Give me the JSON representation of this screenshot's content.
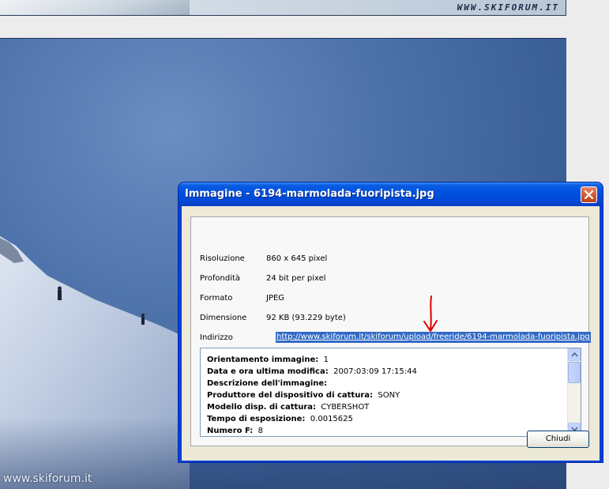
{
  "banner": {
    "url_text": "WWW.SKIFORUM.IT"
  },
  "photo": {
    "caption": "www.skiforum.it"
  },
  "dialog": {
    "title": "Immagine - 6194-marmolada-fuoripista.jpg",
    "close_icon": "close-icon",
    "info": [
      {
        "label": "Risoluzione",
        "value": "860 x 645 pixel"
      },
      {
        "label": "Profondità",
        "value": "24 bit per pixel"
      },
      {
        "label": "Formato",
        "value": "JPEG"
      },
      {
        "label": "Dimensione",
        "value": "92 KB (93.229 byte)"
      },
      {
        "label": "Indirizzo",
        "value": "http://www.skiforum.it/skiforum/upload/freeride/6194-marmolada-fuoripista.jpg"
      }
    ],
    "exif": [
      {
        "label": "Orientamento immagine:",
        "value": "1"
      },
      {
        "label": "Data e ora ultima modifica:",
        "value": "2007:03:09 17:15:44"
      },
      {
        "label": "Descrizione dell'immagine:",
        "value": ""
      },
      {
        "label": "Produttore del dispositivo di cattura:",
        "value": "SONY"
      },
      {
        "label": "Modello disp. di cattura:",
        "value": "CYBERSHOT"
      },
      {
        "label": "Tempo di esposizione:",
        "value": "0.0015625"
      },
      {
        "label": "Numero F:",
        "value": "8"
      }
    ],
    "close_button_label": "Chiudi"
  },
  "colors": {
    "title_bar": "#0050df",
    "selection": "#316ac5",
    "annotation_arrow": "#e00000"
  }
}
